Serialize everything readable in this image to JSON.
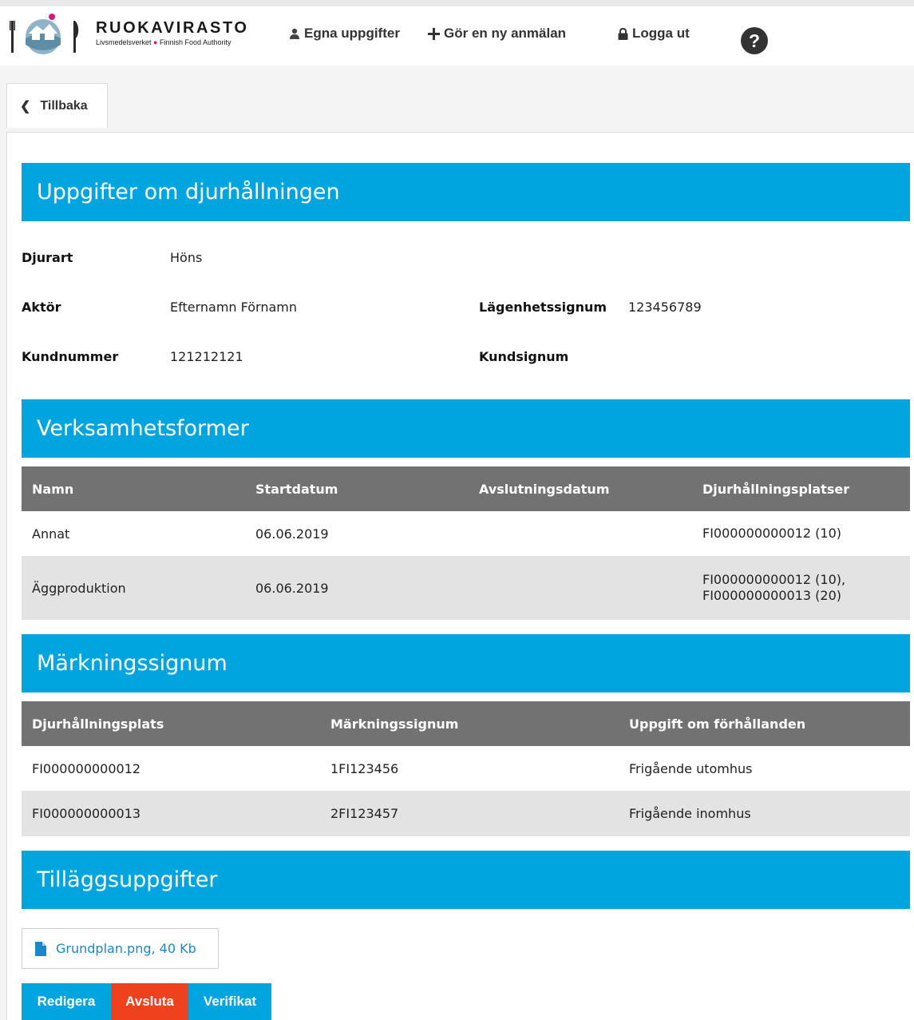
{
  "brand": {
    "name": "RUOKAVIRASTO",
    "sub_left": "Livsmedelsverket",
    "sub_right": "Finnish Food Authority"
  },
  "nav": {
    "profile": "Egna uppgifter",
    "new_report": "Gör en ny anmälan",
    "logout": "Logga ut",
    "help": "?"
  },
  "back": {
    "label": "Tillbaka"
  },
  "animal_section": {
    "title": "Uppgifter om djurhållningen",
    "species_label": "Djurart",
    "species_value": "Höns",
    "operator_label": "Aktör",
    "operator_value": "Efternamn Förnamn",
    "farm_id_label": "Lägenhetssignum",
    "farm_id_value": "123456789",
    "customer_number_label": "Kundnummer",
    "customer_number_value": "121212121",
    "customer_id_label": "Kundsignum",
    "customer_id_value": ""
  },
  "activities": {
    "title": "Verksamhetsformer",
    "columns": [
      "Namn",
      "Startdatum",
      "Avslutningsdatum",
      "Djurhållningsplatser"
    ],
    "rows": [
      {
        "name": "Annat",
        "start": "06.06.2019",
        "end": "",
        "places_1": "FI000000000012 (10)",
        "places_2": ""
      },
      {
        "name": "Äggproduktion",
        "start": "06.06.2019",
        "end": "",
        "places_1": "FI000000000012 (10),",
        "places_2": "FI000000000013 (20)"
      }
    ]
  },
  "markings": {
    "title": "Märkningssignum",
    "columns": [
      "Djurhållningsplats",
      "Märkningssignum",
      "Uppgift om förhållanden"
    ],
    "rows": [
      {
        "place": "FI000000000012",
        "mark": "1FI123456",
        "conditions": "Frigående utomhus"
      },
      {
        "place": "FI000000000013",
        "mark": "2FI123457",
        "conditions": "Frigående inomhus"
      }
    ]
  },
  "extra": {
    "title": "Tilläggsuppgifter",
    "attachment": "Grundplan.png, 40 Kb"
  },
  "actions": {
    "edit": "Redigera",
    "end": "Avsluta",
    "receipt": "Verifikat"
  },
  "colors": {
    "section_blue": "#00a4de",
    "table_header": "#727272",
    "row_alt": "#e3e3e3",
    "end_red": "#f0411f",
    "link_blue": "#1a87c8",
    "brand_dot": "#d11b79"
  },
  "icons": [
    "logo",
    "user-icon",
    "plus-icon",
    "lock-icon",
    "help-icon",
    "chevron-left-icon",
    "file-icon"
  ]
}
